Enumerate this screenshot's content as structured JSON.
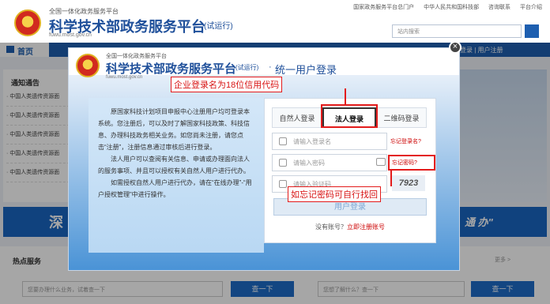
{
  "header": {
    "top_subtitle": "全国一体化政务服务平台",
    "title": "科学技术部政务服务平台",
    "trial": "(试运行)",
    "domain": "fuwu.most.gov.cn",
    "links": [
      "国家政务服务平台总门户",
      "中华人民共和国科技部",
      "咨询联系",
      "平台介绍"
    ],
    "search_placeholder": "站内搜索"
  },
  "nav": {
    "home": "首页",
    "login": "登录",
    "register": "用户注册"
  },
  "left_panel": {
    "title": "通知通告",
    "items": [
      "· 中国人类遗传资源面",
      "· 中国人类遗传资源面",
      "· 中国人类遗传资源面",
      "· 中国人类遗传资源面",
      "· 中国人类遗传资源面"
    ]
  },
  "banner": {
    "left_text": "深",
    "right_text": "通 办\""
  },
  "bottom": {
    "hot_title": "热点服务",
    "more": "更多 >",
    "search1_placeholder": "您要办理什么业务，试着查一下",
    "search1_button": "查一下",
    "search2_placeholder": "您想了解什么？查一下",
    "search2_button": "查一下"
  },
  "modal": {
    "subtitle": "全国一体化政务服务平台",
    "title": "科学技术部政务服务平台",
    "trial": "(试运行)",
    "dot": "·",
    "title2": "统一用户登录",
    "domain": "fuwu.most.gov.cn",
    "intro_p1": "原国家科技计划项目申报中心注册用户均可登录本系统。您注册后，可以及时了解国家科技政策、科技信息、办理科技政务相关业务。如您尚未注册，请您点击“注册”，注册信息通过审核后进行登录。",
    "intro_p2": "法人用户可以查阅有关信息、申请或办理面向法人的服务事项、并且可以授权有关自然人用户进行代办。",
    "intro_p3": "如需授权自然人用户进行代办，请在“在线办理”-“用户授权管理”中进行操作。",
    "tabs": [
      "自然人登录",
      "法人登录",
      "二维码登录"
    ],
    "username_placeholder": "请输入登录名",
    "forgot_username": "忘记登录名?",
    "password_placeholder": "请输入密码",
    "forgot_password": "忘记密码?",
    "captcha_placeholder": "请输入验证码",
    "captcha_text": "7923",
    "login_button": "用户登录",
    "no_account": "没有账号？",
    "register_link": "立即注册账号"
  },
  "annotations": {
    "label1": "企业登录名为18位信用代码",
    "label2": "如忘记密码可自行找回"
  }
}
